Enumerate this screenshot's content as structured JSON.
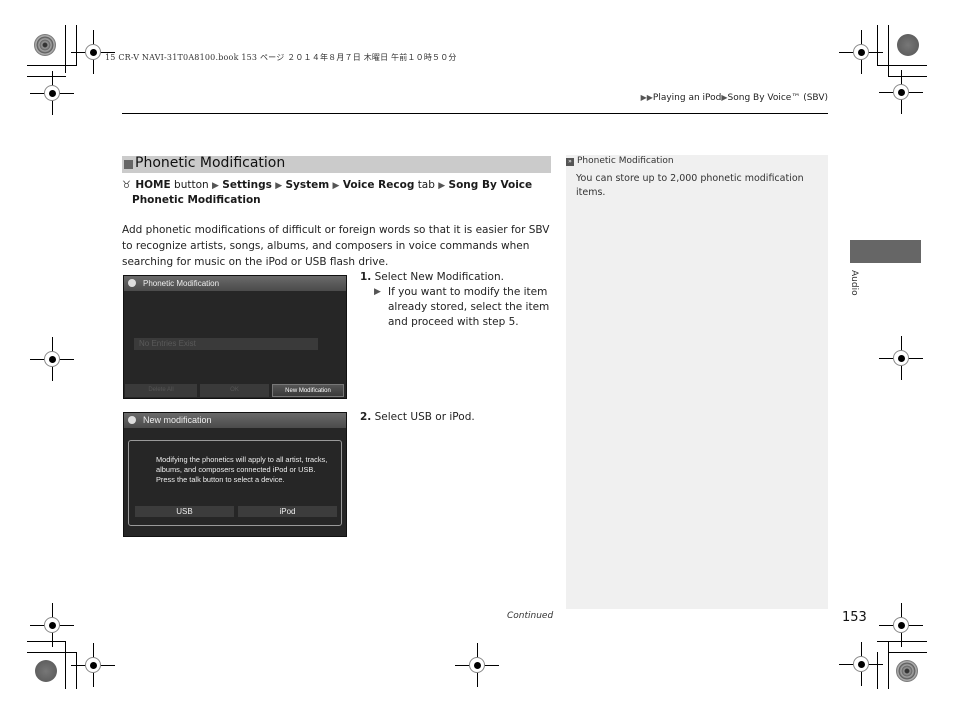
{
  "print_header": "15 CR-V NAVI-31T0A8100.book  153 ページ  ２０１４年８月７日  木曜日  午前１０時５０分",
  "breadcrumb": {
    "lead_arrows": "▶▶",
    "items": [
      "Playing an iPod",
      "Song By Voice™ (SBV)"
    ],
    "separator": "▶"
  },
  "section": {
    "title": "Phonetic Modification"
  },
  "nav_path": {
    "icon": "voice-command-icon",
    "icon_glyph": "♉",
    "parts": [
      {
        "text": "HOME",
        "bold": true
      },
      {
        "text": " button ",
        "bold": false
      },
      {
        "text": "Settings",
        "bold": true
      },
      {
        "text": "System",
        "bold": true
      },
      {
        "text": "Voice Recog",
        "bold": true
      },
      {
        "text": " tab ",
        "bold": false
      },
      {
        "text": "Song By Voice Phonetic Modification",
        "bold": true
      }
    ],
    "home": "HOME",
    "button_word": "button",
    "settings": "Settings",
    "system": "System",
    "voice_recog": "Voice Recog",
    "tab_word": "tab",
    "song_by_voice": "Song By Voice",
    "phonetic_modification": "Phonetic Modification",
    "arrow": "▶"
  },
  "intro": "Add phonetic modifications of difficult or foreign words so that it is easier for SBV to recognize artists, songs, albums, and composers in voice commands when searching for music on the iPod or USB flash drive.",
  "screen1": {
    "title": "Phonetic Modification",
    "empty_text": "No Entries Exist",
    "buttons": [
      {
        "label": "Delete All",
        "enabled": false
      },
      {
        "label": "OK",
        "enabled": false
      },
      {
        "label": "New Modification",
        "enabled": true
      }
    ]
  },
  "step1": {
    "number": "1.",
    "select": "Select",
    "target": "New Modification",
    "period": ".",
    "note": "If you want to modify the item already stored, select the item and proceed with step 5."
  },
  "screen2": {
    "title": "New modification",
    "message": "Modifying the phonetics will apply to all artist, tracks, albums, and composers connected iPod or USB. Press the talk button to select a device.",
    "buttons": [
      {
        "label": "USB"
      },
      {
        "label": "iPod"
      }
    ]
  },
  "step2": {
    "number": "2.",
    "select": "Select",
    "opt1": "USB",
    "or": "or",
    "opt2": "iPod",
    "period": "."
  },
  "sidebar_note": {
    "icon_glyph": "»",
    "title": "Phonetic Modification",
    "body": "You can store up to 2,000 phonetic modification items."
  },
  "side_tab": {
    "label": "Audio"
  },
  "footer": {
    "continued": "Continued",
    "page_number": "153"
  }
}
